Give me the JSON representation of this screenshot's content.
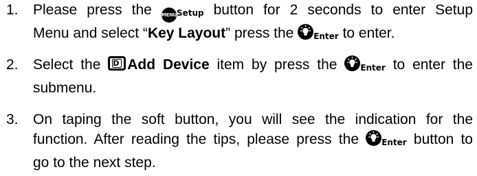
{
  "icons": {
    "menu_icon_text": "MENU",
    "setup_label": "Setup",
    "enter_label": "Enter",
    "d_key_letter": "D"
  },
  "steps": [
    {
      "number": "1.",
      "line1_a": "Please press the ",
      "line1_b": " button for 2 seconds to enter Setup",
      "line2_a": "Menu and select “",
      "line2_bold": "Key Layout",
      "line2_b": "” press the ",
      "line2_c": " to enter."
    },
    {
      "number": "2.",
      "line1_a": "Select the ",
      "line1_bold": "Add Device",
      "line1_b": " item by press the ",
      "line1_c": " to enter the",
      "line2": "submenu."
    },
    {
      "number": "3.",
      "line1": "On taping the soft button, you will see the indication for the",
      "line2_a": "function. After reading the tips, please press the ",
      "line2_b": " button to",
      "line3": "go to the next step."
    }
  ]
}
